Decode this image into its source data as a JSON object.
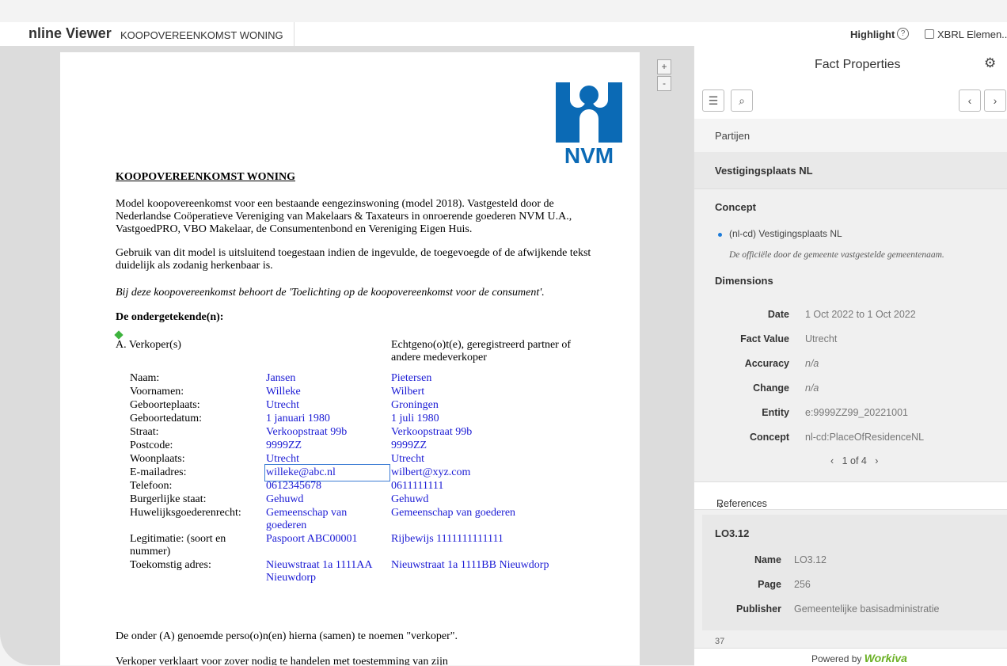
{
  "topbar": {
    "app_title": "nline Viewer",
    "doc_title": "KOOPOVEREENKOMST WONING",
    "highlight_label": "Highlight",
    "help_glyph": "?",
    "xbrl_label": "XBRL Elemen.."
  },
  "viewer": {
    "zoom_in": "+",
    "zoom_out": "-",
    "logo_text": "NVM",
    "heading": "KOOPOVEREENKOMST WONING",
    "para1": "Model koopovereenkomst voor een bestaande eengezinswoning (model 2018). Vastgesteld door de Nederlandse Coöperatieve Vereniging van Makelaars & Taxateurs in onroerende goederen NVM U.A., VastgoedPRO, VBO Makelaar, de Consumentenbond en Vereniging Eigen Huis.",
    "para2": "Gebruik van dit model is uitsluitend toegestaan indien de ingevulde, de toegevoegde of de afwijkende tekst duidelijk als zodanig herkenbaar is.",
    "para3": "Bij deze koopovereenkomst behoort de 'Toelichting op de koopovereenkomst voor de consument'.",
    "undersigned": "De ondergetekende(n):",
    "seller_head": "A. Verkoper(s)",
    "spouse_head": "Echtgeno(o)t(e), geregistreerd partner of andere medeverkoper",
    "fields": [
      {
        "label": "Naam:",
        "v1": "Jansen",
        "v2": "Pietersen"
      },
      {
        "label": "Voornamen:",
        "v1": "Willeke",
        "v2": "Wilbert"
      },
      {
        "label": "Geboorteplaats:",
        "v1": "Utrecht",
        "v2": "Groningen"
      },
      {
        "label": "Geboortedatum:",
        "v1": "1 januari 1980",
        "v2": "1 juli 1980"
      },
      {
        "label": "Straat:",
        "v1": "Verkoopstraat 99b",
        "v2": "Verkoopstraat 99b"
      },
      {
        "label": "Postcode:",
        "v1": "9999ZZ",
        "v2": "9999ZZ"
      },
      {
        "label": "Woonplaats:",
        "v1": "Utrecht",
        "v2": "Utrecht"
      },
      {
        "label": "E-mailadres:",
        "v1": "willeke@abc.nl",
        "v2": "wilbert@xyz.com"
      },
      {
        "label": "Telefoon:",
        "v1": "0612345678",
        "v2": "0611111111"
      },
      {
        "label": "Burgerlijke staat:",
        "v1": "Gehuwd",
        "v2": "Gehuwd"
      },
      {
        "label": "Huwelijksgoederenrecht:",
        "v1": "Gemeenschap van goederen",
        "v2": "Gemeenschap van goederen"
      },
      {
        "label": "Legitimatie: (soort en nummer)",
        "v1": "Paspoort ABC00001",
        "v2": "Rijbewijs 1111111111111"
      },
      {
        "label": "Toekomstig adres:",
        "v1": "Nieuwstraat 1a 1111AA Nieuwdorp",
        "v2": "Nieuwstraat 1a 1111BB Nieuwdorp"
      }
    ],
    "para4": "De onder (A) genoemde perso(o)n(en) hierna (samen) te noemen \"verkoper\".",
    "para5": "Verkoper verklaart voor zover nodig te handelen met toestemming van zijn"
  },
  "panel": {
    "title": "Fact Properties",
    "gear_icon": "gear-icon",
    "crumb": "Partijen",
    "selected_fact": "Vestigingsplaats NL",
    "concept_label": "Concept",
    "concept_name": "(nl-cd) Vestigingsplaats NL",
    "concept_desc": "De officiële door de gemeente vastgestelde gemeentenaam.",
    "dimensions_label": "Dimensions",
    "dims": [
      {
        "label": "Date",
        "value": "1 Oct 2022 to 1 Oct 2022",
        "italic": false
      },
      {
        "label": "Fact Value",
        "value": "Utrecht",
        "italic": false
      },
      {
        "label": "Accuracy",
        "value": "n/a",
        "italic": true
      },
      {
        "label": "Change",
        "value": "n/a",
        "italic": true
      },
      {
        "label": "Entity",
        "value": "e:9999ZZ99_20221001",
        "italic": false
      },
      {
        "label": "Concept",
        "value": "nl-cd:PlaceOfResidenceNL",
        "italic": false
      }
    ],
    "pager": "1 of 4",
    "references_label": "References",
    "ref_id": "LO3.12",
    "ref_fields": [
      {
        "label": "Name",
        "value": "LO3.12"
      },
      {
        "label": "Page",
        "value": "256"
      },
      {
        "label": "Publisher",
        "value": "Gemeentelijke basisadministratie"
      }
    ],
    "next_ref": "37",
    "footer_text": "Powered by",
    "footer_brand": "Workiva"
  }
}
